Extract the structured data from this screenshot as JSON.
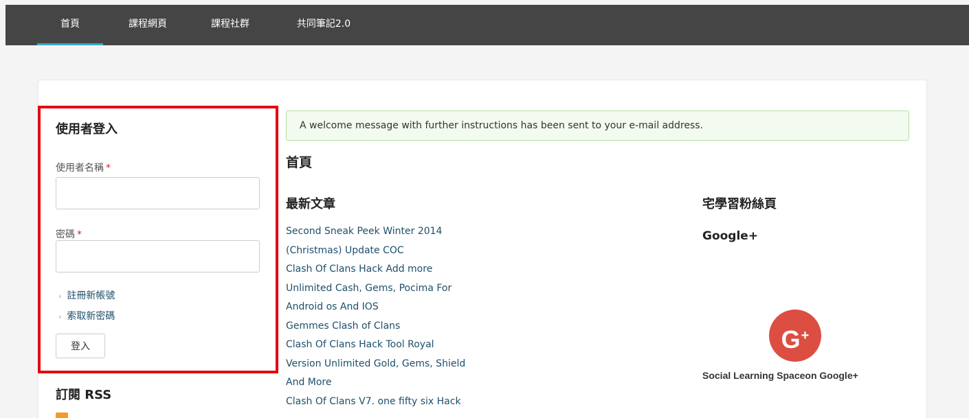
{
  "nav": {
    "items": [
      {
        "label": "首頁",
        "active": true
      },
      {
        "label": "課程網頁",
        "active": false
      },
      {
        "label": "課程社群",
        "active": false
      },
      {
        "label": "共同筆記2.0",
        "active": false
      }
    ]
  },
  "login": {
    "title": "使用者登入",
    "username_label": "使用者名稱",
    "password_label": "密碼",
    "required_marker": "*",
    "username_value": "",
    "password_value": "",
    "register_link": "註冊新帳號",
    "forgot_link": "索取新密碼",
    "submit_label": "登入"
  },
  "rss": {
    "title": "訂閱 RSS",
    "icon": "rss-icon"
  },
  "alert": {
    "message": "A welcome message with further instructions has been sent to your e-mail address."
  },
  "main": {
    "page_title": "首頁",
    "latest_title": "最新文章",
    "articles": [
      "Second Sneak Peek Winter 2014",
      "(Christmas) Update COC",
      "Clash Of Clans Hack Add more",
      "Unlimited Cash, Gems, Pocima For",
      "Android os And IOS",
      "Gemmes Clash of Clans",
      "Clash Of Clans Hack Tool Royal",
      "Version Unlimited Gold, Gems, Shield",
      "And More",
      "Clash Of Clans V7. one fifty six Hack"
    ]
  },
  "fanpage": {
    "title": "宅學習粉絲頁",
    "google_label": "Google+",
    "badge_letter": "G",
    "badge_plus": "+",
    "caption": "Social Learning Spaceon Google+"
  },
  "colors": {
    "navbar": "#454545",
    "nav_active_underline": "#39a8c9",
    "highlight_border": "#e30613",
    "alert_background": "#f3faef",
    "alert_border": "#b8df9f",
    "link": "#1d4f6a",
    "gplus_red": "#dc4e41"
  }
}
